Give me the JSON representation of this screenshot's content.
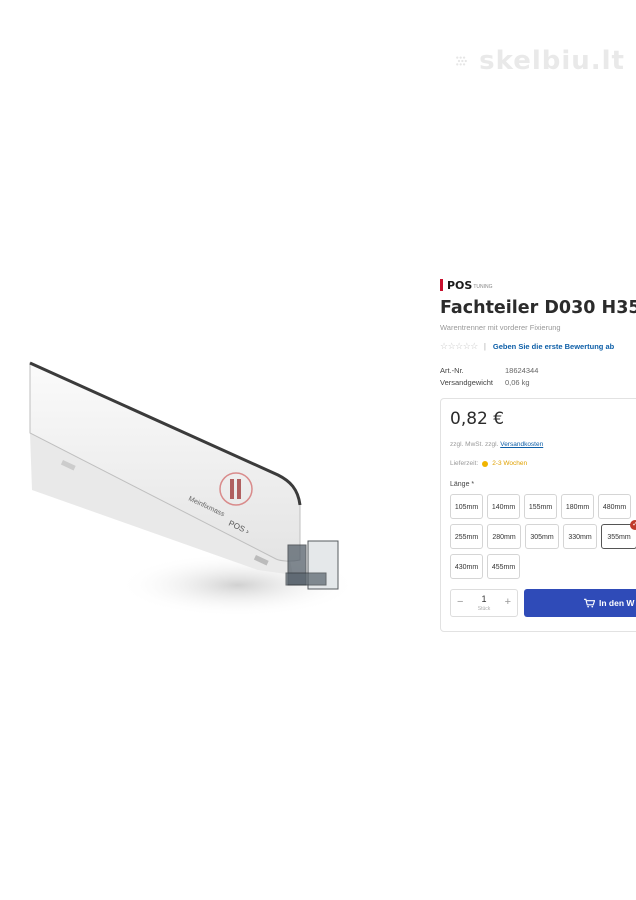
{
  "watermark": {
    "text": "skelbiu.lt"
  },
  "product": {
    "image_icon": "product-divider-image",
    "brand": {
      "name": "POS",
      "tagline": "TUNING"
    },
    "title": "Fachteiler D030 H35",
    "subtitle": "Warentrenner mit vorderer Fixierung",
    "rating": {
      "stars_glyph": "☆☆☆☆☆",
      "separator": "|",
      "review_link": "Geben Sie die erste Bewertung ab"
    },
    "meta": [
      {
        "label": "Art.-Nr.",
        "value": "18624344"
      },
      {
        "label": "Versandgewicht",
        "value": "0,06 kg"
      }
    ]
  },
  "buybox": {
    "price": "0,82 €",
    "tax_note": "zzgl. MwSt. zzgl.",
    "shipping_link": "Versandkosten",
    "delivery_label": "Lieferzeit:",
    "delivery_time": "2-3 Wochen",
    "status_color": "#f0b400",
    "length_label": "Länge *",
    "options": [
      "105mm",
      "140mm",
      "155mm",
      "180mm",
      "480mm",
      "255mm",
      "280mm",
      "305mm",
      "330mm",
      "355mm",
      "430mm",
      "455mm"
    ],
    "selected_option": "355mm",
    "quantity": {
      "value": "1",
      "unit": "Stück",
      "minus": "−",
      "plus": "+"
    },
    "cart_button": "In den W",
    "accent_color": "#2f4bb8"
  }
}
